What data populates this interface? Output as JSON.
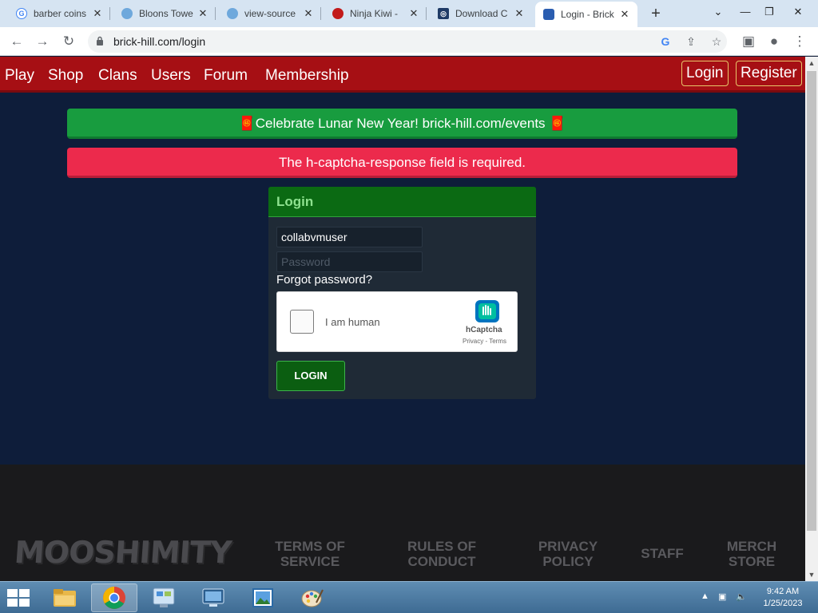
{
  "browser": {
    "tabs": [
      {
        "title": "barber coins",
        "icon": "google-icon"
      },
      {
        "title": "Bloons Towe",
        "icon": "globe-icon"
      },
      {
        "title": "view-source",
        "icon": "globe-icon"
      },
      {
        "title": "Ninja Kiwi - ",
        "icon": "ninjakiwi-icon"
      },
      {
        "title": "Download C",
        "icon": "download-icon"
      },
      {
        "title": "Login - Brick",
        "icon": "brickhill-icon",
        "active": true
      }
    ],
    "new_tab_label": "+",
    "url": "brick-hill.com/login"
  },
  "site_nav": {
    "links": [
      "Play",
      "Shop",
      "Clans",
      "Users",
      "Forum",
      "Membership"
    ],
    "login_label": "Login",
    "register_label": "Register"
  },
  "alerts": {
    "event_banner": "🧧Celebrate Lunar New Year! brick-hill.com/events 🧧",
    "error_banner": "The h-captcha-response field is required."
  },
  "login_form": {
    "heading": "Login",
    "username_value": "collabvmuser",
    "password_placeholder": "Password",
    "forgot_label": "Forgot password?",
    "captcha_label": "I am human",
    "captcha_brand": "hCaptcha",
    "captcha_links": "Privacy - Terms",
    "submit_label": "LOGIN"
  },
  "footer": {
    "logo_text": "MOOSHIMITY",
    "links": [
      "TERMS OF SERVICE",
      "RULES OF CONDUCT",
      "PRIVACY POLICY",
      "STAFF",
      "MERCH STORE"
    ]
  },
  "taskbar": {
    "time": "9:42 AM",
    "date": "1/25/2023"
  },
  "colors": {
    "nav_red": "#a60f14",
    "page_bg": "#0e1d3a",
    "success_green": "#189c3f",
    "error_red": "#ec2a4c",
    "card_header_green": "#0b6a13"
  }
}
